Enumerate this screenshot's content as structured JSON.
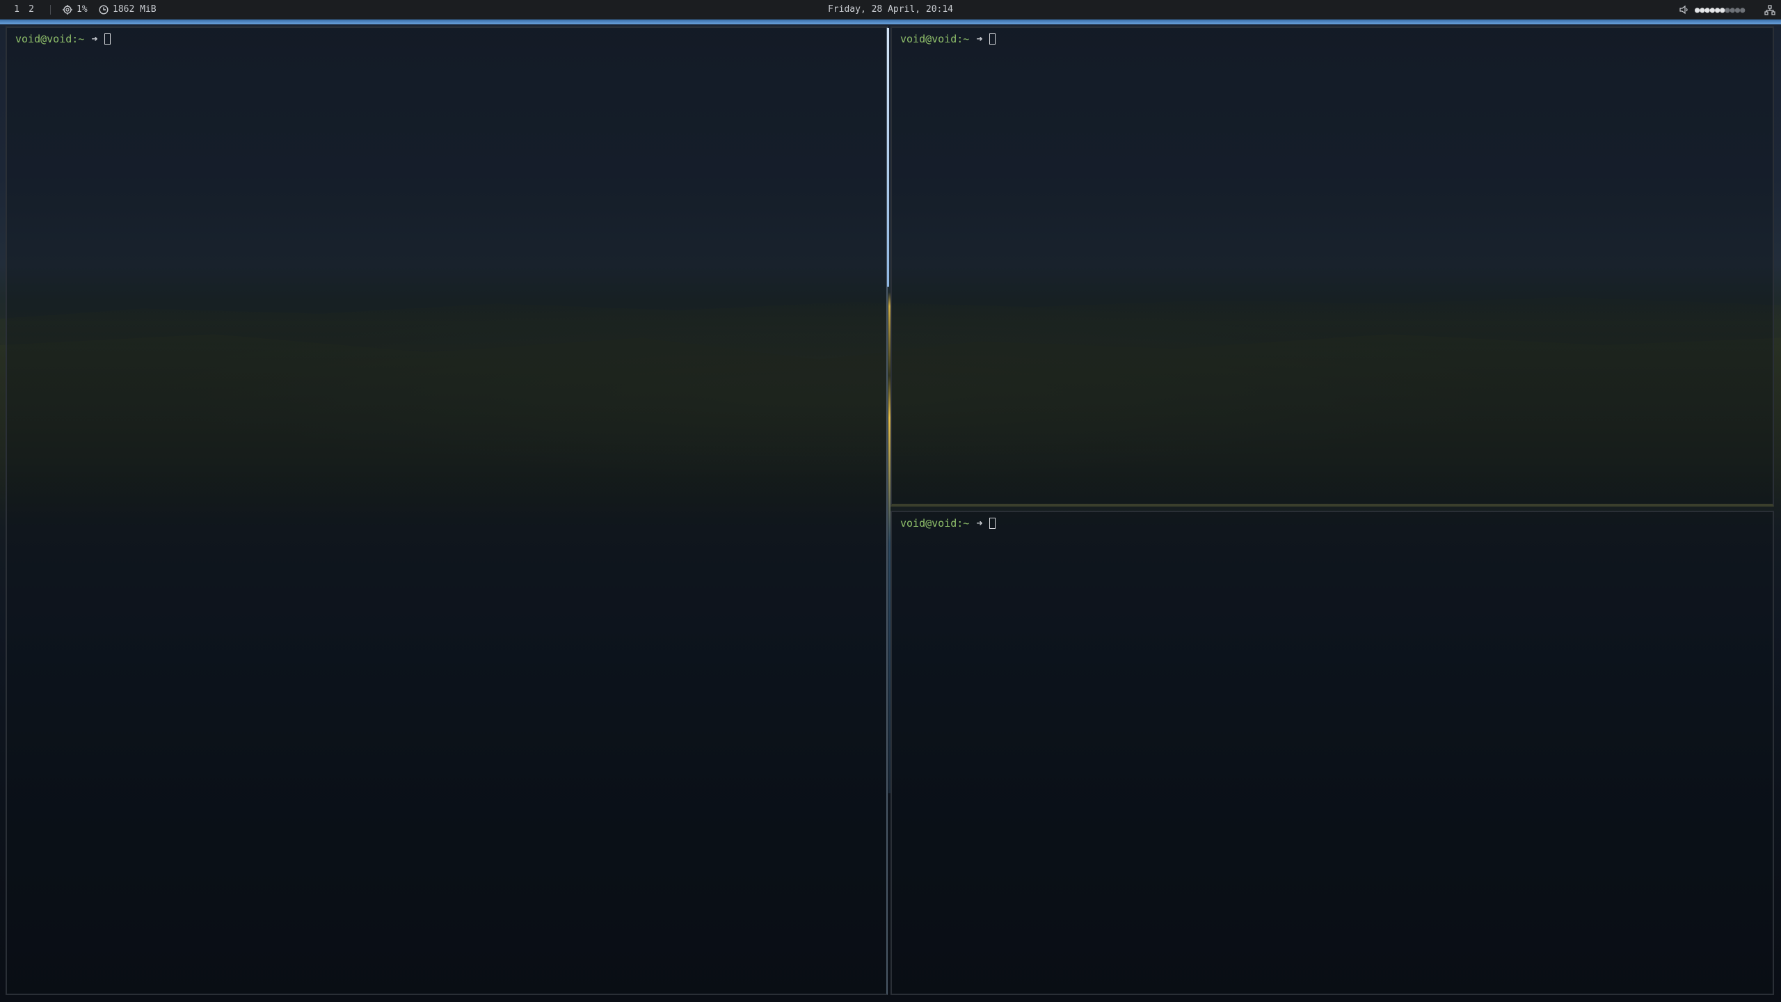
{
  "topbar": {
    "workspaces": [
      "1",
      "2"
    ],
    "cpu_usage": "1%",
    "memory_usage": "1862 MiB",
    "datetime": "Friday, 28 April, 20:14",
    "volume_level": 0.6
  },
  "terminals": {
    "left": {
      "prompt_user": "void@void:~",
      "prompt_symbol": "➜"
    },
    "right_top": {
      "prompt_user": "void@void:~",
      "prompt_symbol": "➜"
    },
    "right_bottom": {
      "prompt_user": "void@void:~",
      "prompt_symbol": "➜"
    }
  },
  "icons": {
    "cpu": "cpu-gear-icon",
    "memory": "clock-memory-icon",
    "volume": "speaker-icon",
    "network": "network-icon"
  },
  "colors": {
    "bar_background": "#1b1d20",
    "accent": "#6aa2dc",
    "prompt_green": "#8fbf6a"
  }
}
